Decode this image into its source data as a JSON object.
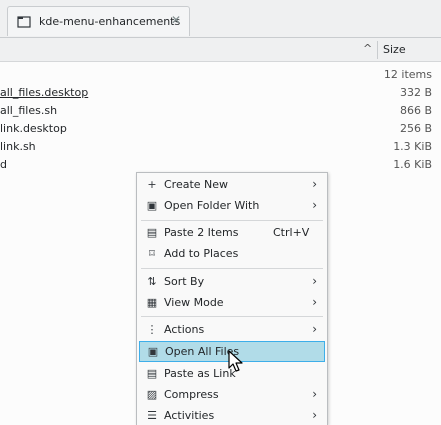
{
  "tab": {
    "title": "kde-menu-enhancements",
    "close_glyph": "✕"
  },
  "header": {
    "size_label": "Size",
    "sort_glyph": "^"
  },
  "files": {
    "summary": "12 items",
    "rows": [
      {
        "name": "all_files.desktop",
        "size": "332 B"
      },
      {
        "name": "all_files.sh",
        "size": "866 B"
      },
      {
        "name": "link.desktop",
        "size": "256 B"
      },
      {
        "name": "link.sh",
        "size": "1.3 KiB"
      },
      {
        "name": "d",
        "size": "1.6 KiB"
      }
    ]
  },
  "menu": {
    "items": [
      {
        "label": "Create New",
        "icon": "plus-icon",
        "glyph": "+",
        "submenu": true
      },
      {
        "label": "Open Folder With",
        "icon": "open-with-icon",
        "glyph": "▣",
        "submenu": true
      },
      {
        "label": "Paste 2 Items",
        "icon": "paste-icon",
        "glyph": "▤",
        "shortcut": "Ctrl+V"
      },
      {
        "label": "Add to Places",
        "icon": "bookmark-icon",
        "glyph": "⌑"
      },
      {
        "label": "Sort By",
        "icon": "sort-icon",
        "glyph": "⇅",
        "submenu": true
      },
      {
        "label": "View Mode",
        "icon": "view-mode-icon",
        "glyph": "▦",
        "submenu": true
      },
      {
        "label": "Actions",
        "icon": "actions-icon",
        "glyph": "⋮",
        "submenu": true
      },
      {
        "label": "Open All Files",
        "icon": "open-files-icon",
        "glyph": "▣",
        "highlighted": true
      },
      {
        "label": "Paste as Link",
        "icon": "paste-link-icon",
        "glyph": "▤"
      },
      {
        "label": "Compress",
        "icon": "compress-icon",
        "glyph": "▨",
        "submenu": true
      },
      {
        "label": "Activities",
        "icon": "activities-icon",
        "glyph": "☰",
        "submenu": true
      }
    ],
    "arrow_glyph": "›"
  },
  "colors": {
    "highlight_bg": "#b1dce8",
    "highlight_border": "#3daee9",
    "accent": "#3daee9"
  }
}
